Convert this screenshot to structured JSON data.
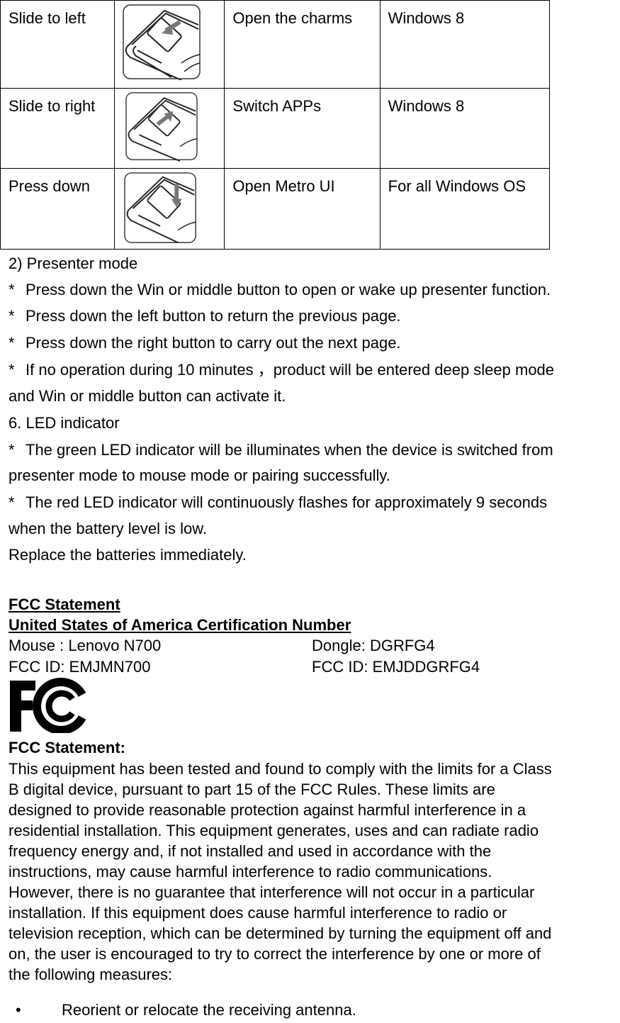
{
  "gesture_table": {
    "rows": [
      {
        "gesture": "Slide to left",
        "icon": "mouse-slide-left-icon",
        "arrow": "left",
        "action": "Open the charms",
        "os": "Windows 8"
      },
      {
        "gesture": "Slide to right",
        "icon": "mouse-slide-right-icon",
        "arrow": "right",
        "action": "Switch APPs",
        "os": "Windows 8"
      },
      {
        "gesture": "Press down",
        "icon": "mouse-press-down-icon",
        "arrow": "down",
        "action": "Open Metro UI",
        "os": "For all Windows OS"
      }
    ]
  },
  "presenter": {
    "heading": "2) Presenter mode",
    "bullet_glyph": "*",
    "items": [
      "Press down the Win or middle button to open or wake up presenter function.",
      "Press down the left button to return the previous page.",
      "Press down the right button to carry out the next page.",
      "If no operation during 10 minutes ，product will be entered deep sleep mode"
    ],
    "continuation": "and Win or middle button can activate it."
  },
  "led": {
    "heading": "6. LED indicator",
    "item1_line1": "The green LED indicator will be illuminates when the device is switched from",
    "item1_line2": "presenter mode to mouse mode or pairing successfully.",
    "item2_line1": "The red LED indicator will continuously flashes for approximately 9 seconds",
    "item2_line2": "when the battery level is low.",
    "replace": "Replace the batteries immediately."
  },
  "fcc": {
    "title": "FCC Statement",
    "cert_title": "United States of America Certification Number",
    "mouse_label": "Mouse : Lenovo N700",
    "mouse_fcc_id": "FCC ID: EMJMN700",
    "dongle_label": "Dongle: DGRFG4",
    "dongle_fcc_id": "FCC ID: EMJDDGRFG4",
    "logo": "fcc-logo",
    "statement_heading": "FCC Statement:",
    "statement_lines": [
      "This equipment has been tested and found to comply with the limits for a Class",
      "B digital device, pursuant to part 15 of the FCC Rules. These limits are",
      "designed to provide reasonable protection against harmful interference in a",
      "residential installation. This equipment generates, uses and can radiate radio",
      "frequency energy and, if not installed and used in accordance with the",
      "instructions, may cause harmful interference to radio communications.",
      "However, there is no guarantee that interference will not occur in a particular",
      "installation. If this equipment does cause harmful interference to radio or",
      "television reception, which can be determined by turning the equipment off and",
      "on, the user is encouraged to try to correct the interference by one or more of",
      "the following measures:"
    ],
    "measures_bullet": "•",
    "measures": [
      "Reorient or relocate the receiving antenna."
    ]
  }
}
